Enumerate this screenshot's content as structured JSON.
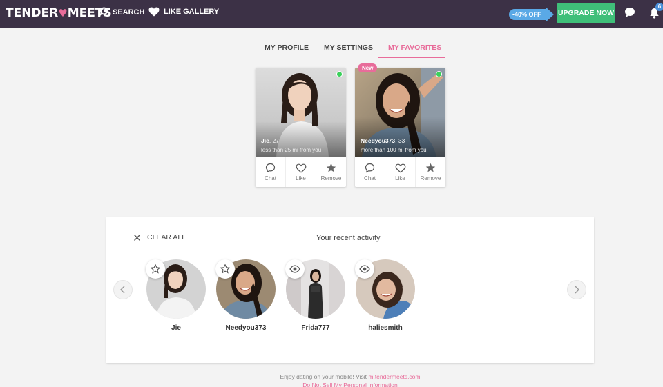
{
  "header": {
    "logo_left": "TENDER",
    "logo_right": "MEETS",
    "nav": {
      "search": "SEARCH",
      "like_gallery": "LIKE GALLERY"
    },
    "promo": "-40% OFF",
    "upgrade": "UPGRADE NOW",
    "notifications_count": "6",
    "icons": [
      "search-icon",
      "heart-icon",
      "chat-icon",
      "bell-icon"
    ]
  },
  "tabs": [
    {
      "label": "MY PROFILE",
      "active": false
    },
    {
      "label": "MY SETTINGS",
      "active": false
    },
    {
      "label": "MY FAVORITES",
      "active": true
    }
  ],
  "favorites": [
    {
      "name": "Jie",
      "age": ", 27",
      "distance": "less than 25 mi from you",
      "online": true,
      "new": false
    },
    {
      "name": "Needyou373",
      "age": ", 33",
      "distance": "more than 100 mi from you",
      "online": true,
      "new": true,
      "new_label": "New"
    }
  ],
  "card_actions": {
    "chat": "Chat",
    "like": "Like",
    "remove": "Remove"
  },
  "activity": {
    "clear_all": "CLEAR ALL",
    "title": "Your recent activity",
    "items": [
      {
        "name": "Jie",
        "action": "star-icon"
      },
      {
        "name": "Needyou373",
        "action": "star-icon"
      },
      {
        "name": "Frida777",
        "action": "eye-icon"
      },
      {
        "name": "haliesmith",
        "action": "eye-icon"
      }
    ]
  },
  "footer": {
    "text": "Enjoy dating on your mobile! Visit ",
    "link": "m.tendermeets.com",
    "privacy": "Do Not Sell My Personal Information"
  },
  "colors": {
    "header_bg": "#3c3146",
    "accent_pink": "#e86c9a",
    "upgrade_green": "#3fbf79",
    "promo_blue": "#5aa9e6",
    "online_green": "#3bd15b"
  }
}
